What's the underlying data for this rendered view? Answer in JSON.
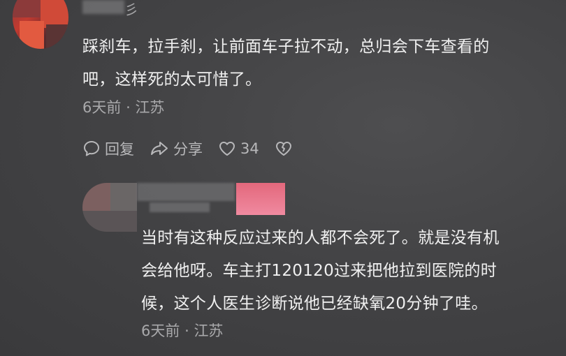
{
  "comment": {
    "username_suffix": "彡",
    "text": "踩刹车，拉手刹，让前面车子拉不动，总归会下车查看的\n吧，这样死的太可惜了。",
    "time": "6天前",
    "separator": "·",
    "location": "江苏",
    "actions": {
      "reply_label": "回复",
      "share_label": "分享",
      "like_count": "34"
    }
  },
  "reply": {
    "text": "当时有这种反应过来的人都不会死了。就是没有机\n会给他呀。车主打120120过来把他拉到医院的时\n候，这个人医生诊断说他已经缺氧20分钟了哇。",
    "time": "6天前",
    "separator": "·",
    "location": "江苏"
  },
  "icons": {
    "reply": "comment-bubble-icon",
    "share": "share-arrow-icon",
    "like": "heart-icon",
    "dislike": "broken-heart-icon"
  },
  "colors": {
    "background": "#434345",
    "text": "#f0f0f0",
    "meta": "#a9a9ab",
    "reply_badge": "#e3687c"
  }
}
